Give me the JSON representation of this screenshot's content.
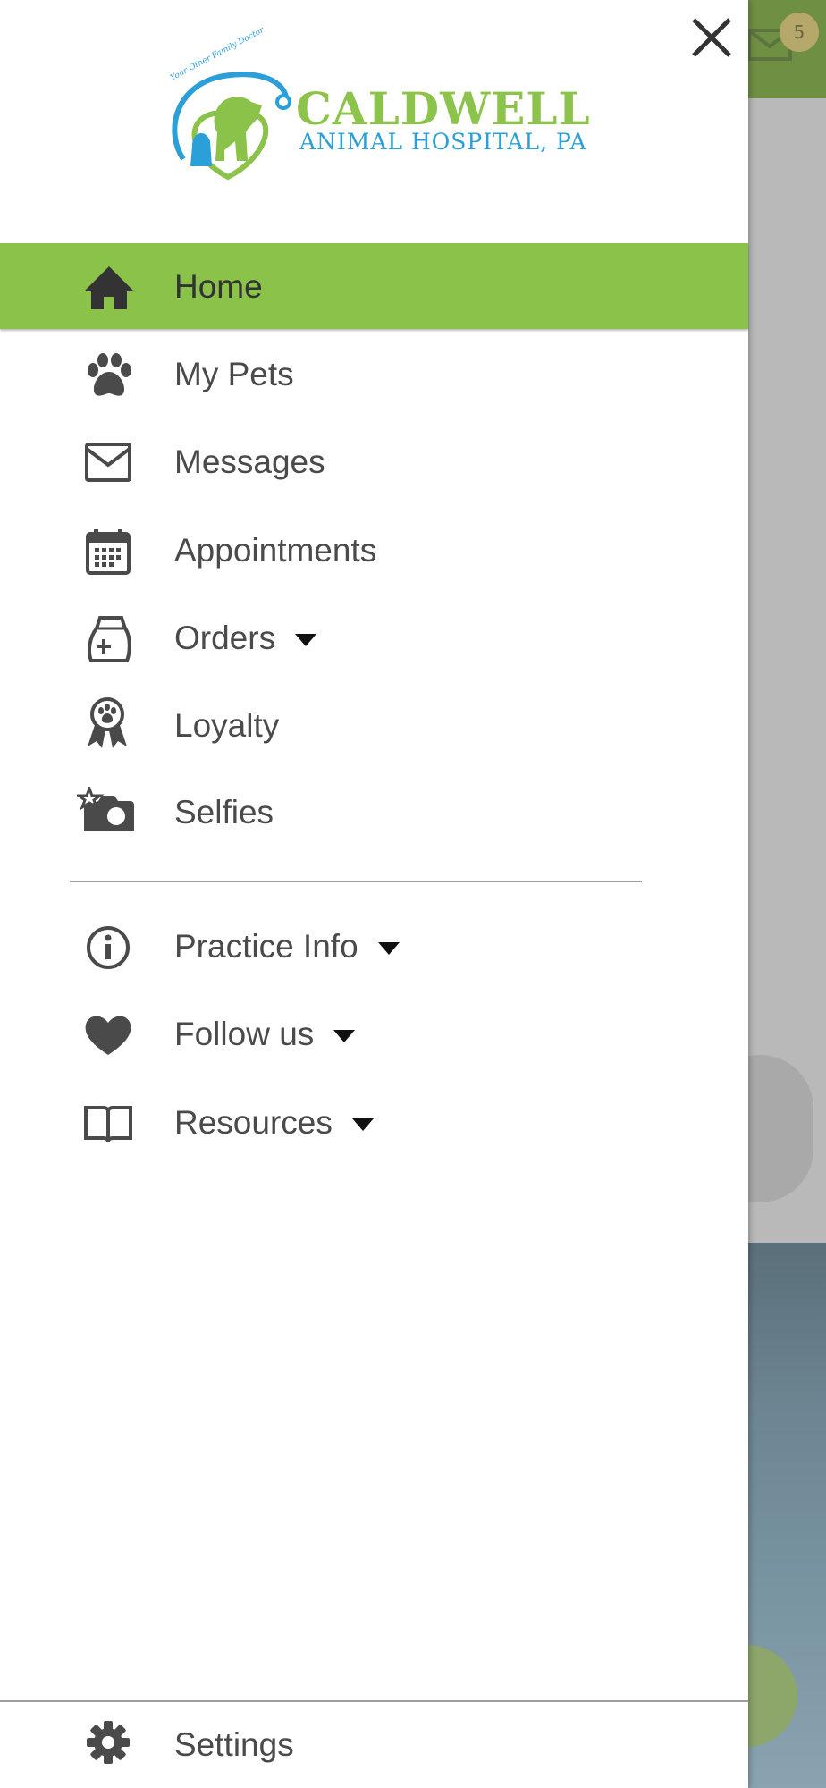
{
  "background": {
    "badge_count": "5"
  },
  "logo": {
    "title": "CALDWELL",
    "subtitle": "ANIMAL HOSPITAL, PA",
    "tagline": "Your Other Family Doctor"
  },
  "menu": {
    "items": [
      {
        "label": "Home",
        "icon": "home-icon",
        "active": true
      },
      {
        "label": "My Pets",
        "icon": "paw-icon"
      },
      {
        "label": "Messages",
        "icon": "mail-icon"
      },
      {
        "label": "Appointments",
        "icon": "calendar-icon"
      },
      {
        "label": "Orders",
        "icon": "medicine-bag-icon",
        "has_dropdown": true
      },
      {
        "label": "Loyalty",
        "icon": "award-ribbon-icon"
      },
      {
        "label": "Selfies",
        "icon": "camera-icon"
      }
    ],
    "secondary": [
      {
        "label": "Practice Info",
        "icon": "info-icon",
        "has_dropdown": true
      },
      {
        "label": "Follow us",
        "icon": "heart-icon",
        "has_dropdown": true
      },
      {
        "label": "Resources",
        "icon": "book-icon",
        "has_dropdown": true
      }
    ],
    "settings": {
      "label": "Settings",
      "icon": "gear-icon"
    }
  },
  "colors": {
    "accent": "#8bc34a",
    "icon": "#4a4a4a",
    "logo_green": "#8cc34a",
    "logo_blue": "#2b9fd8"
  }
}
